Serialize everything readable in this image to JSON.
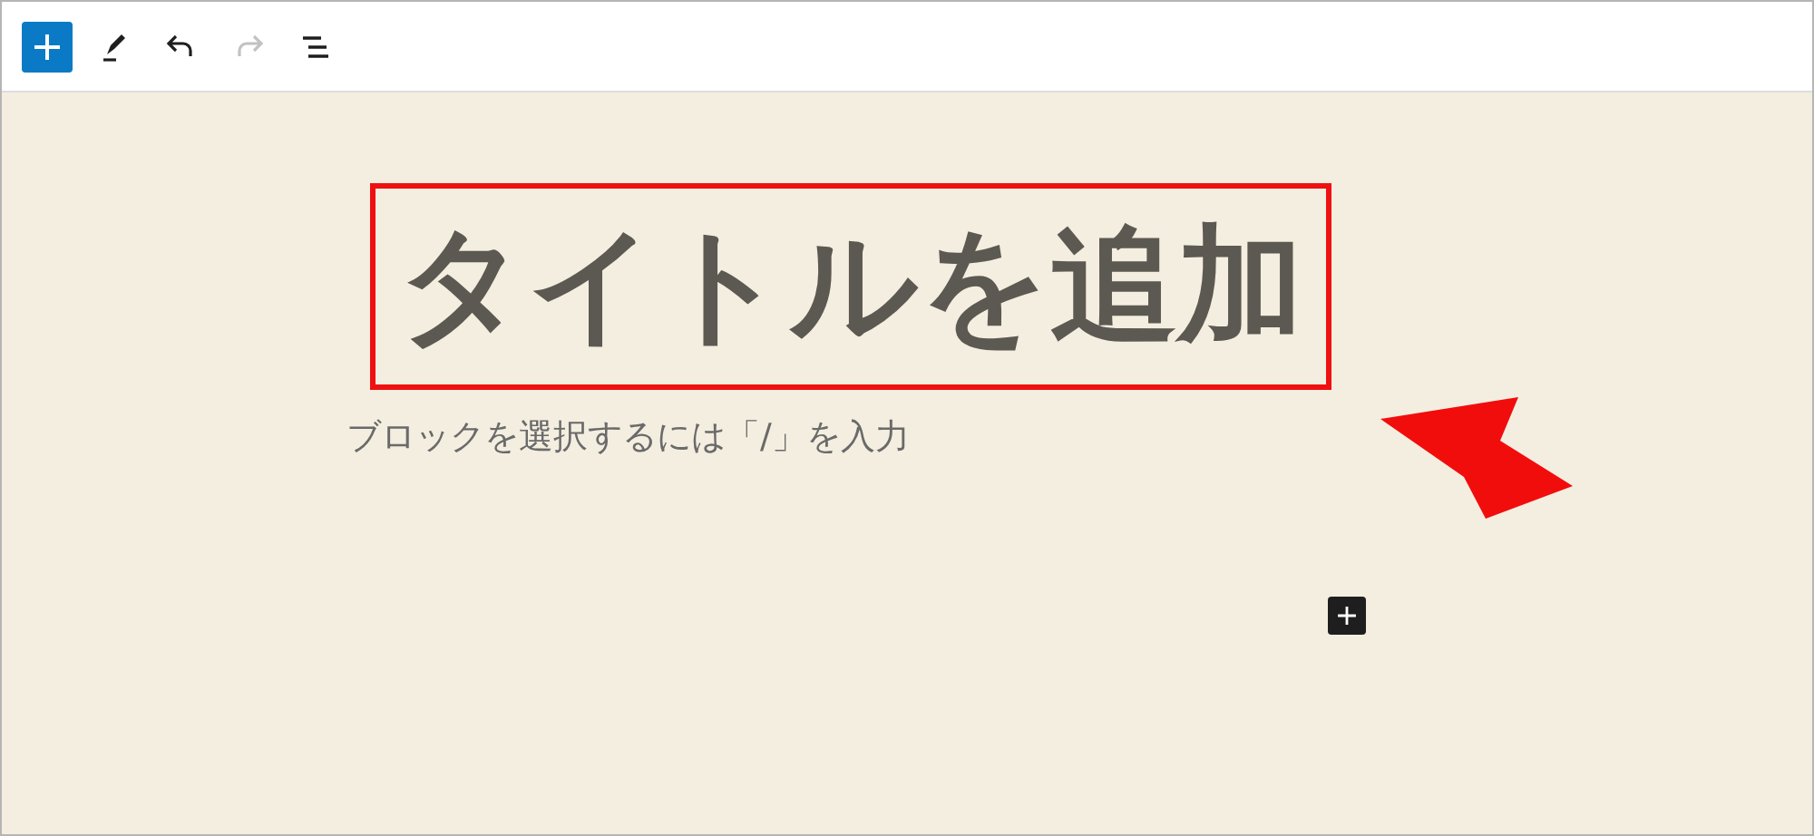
{
  "toolbar": {
    "buttons": [
      {
        "kind": "add",
        "disabled": false,
        "primary": true
      },
      {
        "kind": "pen",
        "disabled": false,
        "primary": false
      },
      {
        "kind": "undo",
        "disabled": false,
        "primary": false
      },
      {
        "kind": "redo",
        "disabled": true,
        "primary": false
      },
      {
        "kind": "outline",
        "disabled": false,
        "primary": false
      }
    ]
  },
  "editor": {
    "title_placeholder": "タイトルを追加",
    "title_highlighted": true,
    "block_placeholder": "ブロックを選択するには「/」を入力",
    "inserter": {
      "kind": "add"
    }
  },
  "annotation": {
    "arrow": true
  }
}
